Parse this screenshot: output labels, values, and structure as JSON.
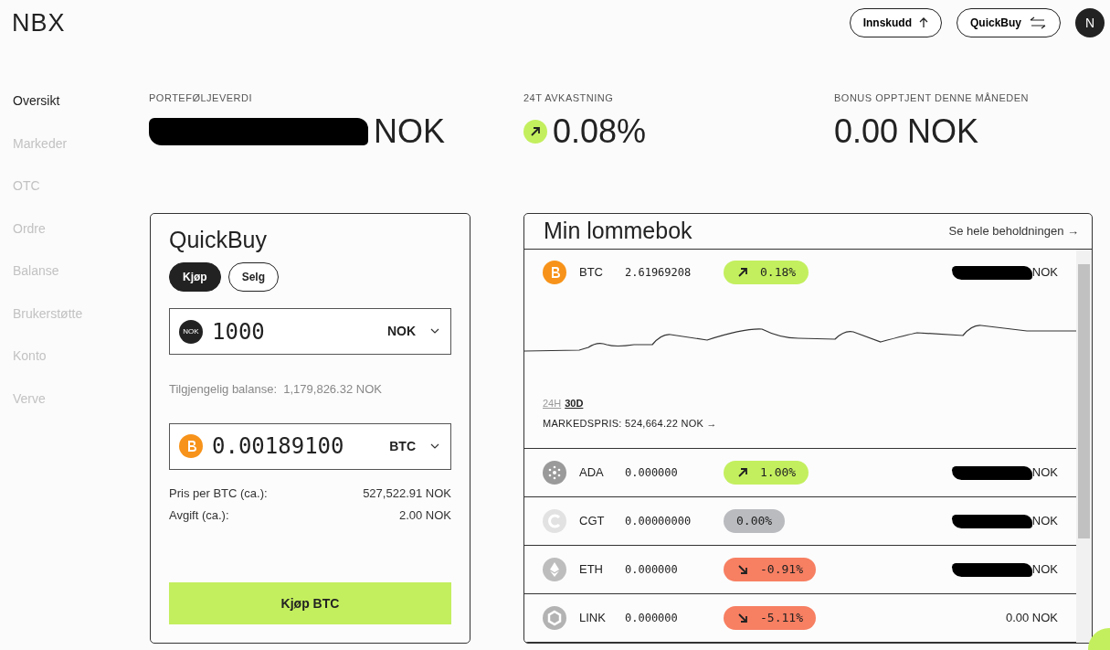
{
  "logo": "NBX",
  "header_buttons": [
    {
      "label": "Innskudd",
      "kind": "deposit"
    },
    {
      "label": "QuickBuy",
      "kind": "swap"
    }
  ],
  "avatar": "N",
  "sidebar": {
    "items": [
      {
        "label": "Oversikt",
        "selected": true
      },
      {
        "label": "Markeder",
        "selected": false
      },
      {
        "label": "OTC",
        "selected": false
      },
      {
        "label": "Ordre",
        "selected": false
      },
      {
        "label": "Balanse",
        "selected": false
      },
      {
        "label": "Brukerstøtte",
        "selected": false
      },
      {
        "label": "Konto",
        "selected": false
      },
      {
        "label": "Verve",
        "selected": false
      }
    ]
  },
  "stats": [
    {
      "label": "PORTEFØLJEVERDI",
      "value": "NOK",
      "redacted": true
    },
    {
      "label": "24T AVKASTNING",
      "value": "0.08%",
      "kind": "up"
    },
    {
      "label": "BONUS OPPTJENT DENNE MÅNEDEN",
      "value": "0.00 NOK"
    }
  ],
  "quickbuy": {
    "title": "QuickBuy",
    "modes": [
      {
        "label": "Kjøp",
        "selected": true
      },
      {
        "label": "Selg",
        "selected": false
      }
    ],
    "pay": {
      "kind": "fiat",
      "badge": "NOK",
      "value": "1000",
      "currency": "NOK"
    },
    "balance_label": "Tilgjengelig balanse:",
    "balance": "1,179,826.32 NOK",
    "receive": {
      "kind": "coin",
      "value": "0.00189100",
      "currency": "BTC"
    },
    "details": [
      {
        "label": "Pris per BTC (ca.):",
        "value": "527,522.91 NOK"
      },
      {
        "label": "Avgift (ca.):",
        "value": "2.00 NOK"
      }
    ],
    "submit": "Kjøp BTC"
  },
  "wallet": {
    "title": "Min lommebok",
    "link": "Se hele beholdningen →",
    "assets": [
      {
        "symbol": "BTC",
        "color": "#f7931a",
        "amount": "2.61969208",
        "change": "0.18%",
        "kind": "up",
        "value": "NOK",
        "redacted": true,
        "expanded": true,
        "periods": [
          {
            "label": "24H",
            "selected": false
          },
          {
            "label": "30D",
            "selected": true
          }
        ],
        "market_price": "MARKEDSPRIS: 524,664.22 NOK →"
      },
      {
        "symbol": "ADA",
        "color": "#9a9a9a",
        "amount": "0.000000",
        "change": "1.00%",
        "kind": "up",
        "value": "NOK",
        "redacted": true,
        "expanded": false
      },
      {
        "symbol": "CGT",
        "color": "#e2e2e2",
        "amount": "0.00000000",
        "change": "0.00%",
        "kind": "flat",
        "value": "NOK",
        "redacted": true,
        "expanded": false
      },
      {
        "symbol": "ETH",
        "color": "#bdbdbd",
        "amount": "0.000000",
        "change": "-0.91%",
        "kind": "down",
        "value": "NOK",
        "redacted": true,
        "expanded": false
      },
      {
        "symbol": "LINK",
        "color": "#b3b3b3",
        "amount": "0.000000",
        "change": "-5.11%",
        "kind": "down",
        "value": "0.00 NOK",
        "redacted": false,
        "expanded": false
      }
    ]
  }
}
